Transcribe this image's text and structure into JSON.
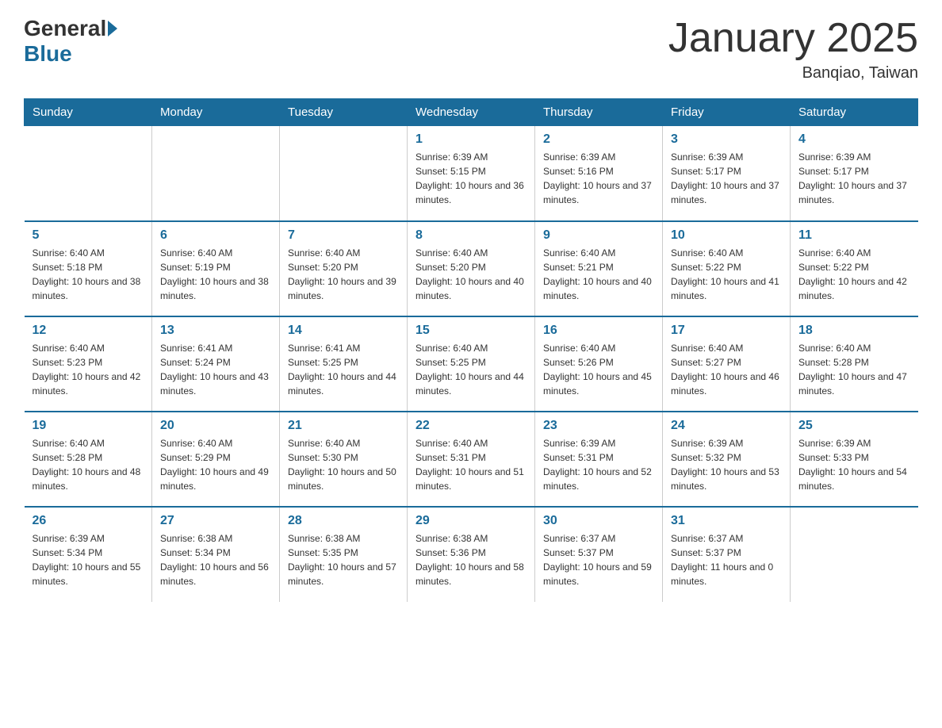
{
  "header": {
    "logo_general": "General",
    "logo_blue": "Blue",
    "month_title": "January 2025",
    "location": "Banqiao, Taiwan"
  },
  "days_of_week": [
    "Sunday",
    "Monday",
    "Tuesday",
    "Wednesday",
    "Thursday",
    "Friday",
    "Saturday"
  ],
  "weeks": [
    [
      {
        "day": "",
        "info": ""
      },
      {
        "day": "",
        "info": ""
      },
      {
        "day": "",
        "info": ""
      },
      {
        "day": "1",
        "info": "Sunrise: 6:39 AM\nSunset: 5:15 PM\nDaylight: 10 hours and 36 minutes."
      },
      {
        "day": "2",
        "info": "Sunrise: 6:39 AM\nSunset: 5:16 PM\nDaylight: 10 hours and 37 minutes."
      },
      {
        "day": "3",
        "info": "Sunrise: 6:39 AM\nSunset: 5:17 PM\nDaylight: 10 hours and 37 minutes."
      },
      {
        "day": "4",
        "info": "Sunrise: 6:39 AM\nSunset: 5:17 PM\nDaylight: 10 hours and 37 minutes."
      }
    ],
    [
      {
        "day": "5",
        "info": "Sunrise: 6:40 AM\nSunset: 5:18 PM\nDaylight: 10 hours and 38 minutes."
      },
      {
        "day": "6",
        "info": "Sunrise: 6:40 AM\nSunset: 5:19 PM\nDaylight: 10 hours and 38 minutes."
      },
      {
        "day": "7",
        "info": "Sunrise: 6:40 AM\nSunset: 5:20 PM\nDaylight: 10 hours and 39 minutes."
      },
      {
        "day": "8",
        "info": "Sunrise: 6:40 AM\nSunset: 5:20 PM\nDaylight: 10 hours and 40 minutes."
      },
      {
        "day": "9",
        "info": "Sunrise: 6:40 AM\nSunset: 5:21 PM\nDaylight: 10 hours and 40 minutes."
      },
      {
        "day": "10",
        "info": "Sunrise: 6:40 AM\nSunset: 5:22 PM\nDaylight: 10 hours and 41 minutes."
      },
      {
        "day": "11",
        "info": "Sunrise: 6:40 AM\nSunset: 5:22 PM\nDaylight: 10 hours and 42 minutes."
      }
    ],
    [
      {
        "day": "12",
        "info": "Sunrise: 6:40 AM\nSunset: 5:23 PM\nDaylight: 10 hours and 42 minutes."
      },
      {
        "day": "13",
        "info": "Sunrise: 6:41 AM\nSunset: 5:24 PM\nDaylight: 10 hours and 43 minutes."
      },
      {
        "day": "14",
        "info": "Sunrise: 6:41 AM\nSunset: 5:25 PM\nDaylight: 10 hours and 44 minutes."
      },
      {
        "day": "15",
        "info": "Sunrise: 6:40 AM\nSunset: 5:25 PM\nDaylight: 10 hours and 44 minutes."
      },
      {
        "day": "16",
        "info": "Sunrise: 6:40 AM\nSunset: 5:26 PM\nDaylight: 10 hours and 45 minutes."
      },
      {
        "day": "17",
        "info": "Sunrise: 6:40 AM\nSunset: 5:27 PM\nDaylight: 10 hours and 46 minutes."
      },
      {
        "day": "18",
        "info": "Sunrise: 6:40 AM\nSunset: 5:28 PM\nDaylight: 10 hours and 47 minutes."
      }
    ],
    [
      {
        "day": "19",
        "info": "Sunrise: 6:40 AM\nSunset: 5:28 PM\nDaylight: 10 hours and 48 minutes."
      },
      {
        "day": "20",
        "info": "Sunrise: 6:40 AM\nSunset: 5:29 PM\nDaylight: 10 hours and 49 minutes."
      },
      {
        "day": "21",
        "info": "Sunrise: 6:40 AM\nSunset: 5:30 PM\nDaylight: 10 hours and 50 minutes."
      },
      {
        "day": "22",
        "info": "Sunrise: 6:40 AM\nSunset: 5:31 PM\nDaylight: 10 hours and 51 minutes."
      },
      {
        "day": "23",
        "info": "Sunrise: 6:39 AM\nSunset: 5:31 PM\nDaylight: 10 hours and 52 minutes."
      },
      {
        "day": "24",
        "info": "Sunrise: 6:39 AM\nSunset: 5:32 PM\nDaylight: 10 hours and 53 minutes."
      },
      {
        "day": "25",
        "info": "Sunrise: 6:39 AM\nSunset: 5:33 PM\nDaylight: 10 hours and 54 minutes."
      }
    ],
    [
      {
        "day": "26",
        "info": "Sunrise: 6:39 AM\nSunset: 5:34 PM\nDaylight: 10 hours and 55 minutes."
      },
      {
        "day": "27",
        "info": "Sunrise: 6:38 AM\nSunset: 5:34 PM\nDaylight: 10 hours and 56 minutes."
      },
      {
        "day": "28",
        "info": "Sunrise: 6:38 AM\nSunset: 5:35 PM\nDaylight: 10 hours and 57 minutes."
      },
      {
        "day": "29",
        "info": "Sunrise: 6:38 AM\nSunset: 5:36 PM\nDaylight: 10 hours and 58 minutes."
      },
      {
        "day": "30",
        "info": "Sunrise: 6:37 AM\nSunset: 5:37 PM\nDaylight: 10 hours and 59 minutes."
      },
      {
        "day": "31",
        "info": "Sunrise: 6:37 AM\nSunset: 5:37 PM\nDaylight: 11 hours and 0 minutes."
      },
      {
        "day": "",
        "info": ""
      }
    ]
  ]
}
